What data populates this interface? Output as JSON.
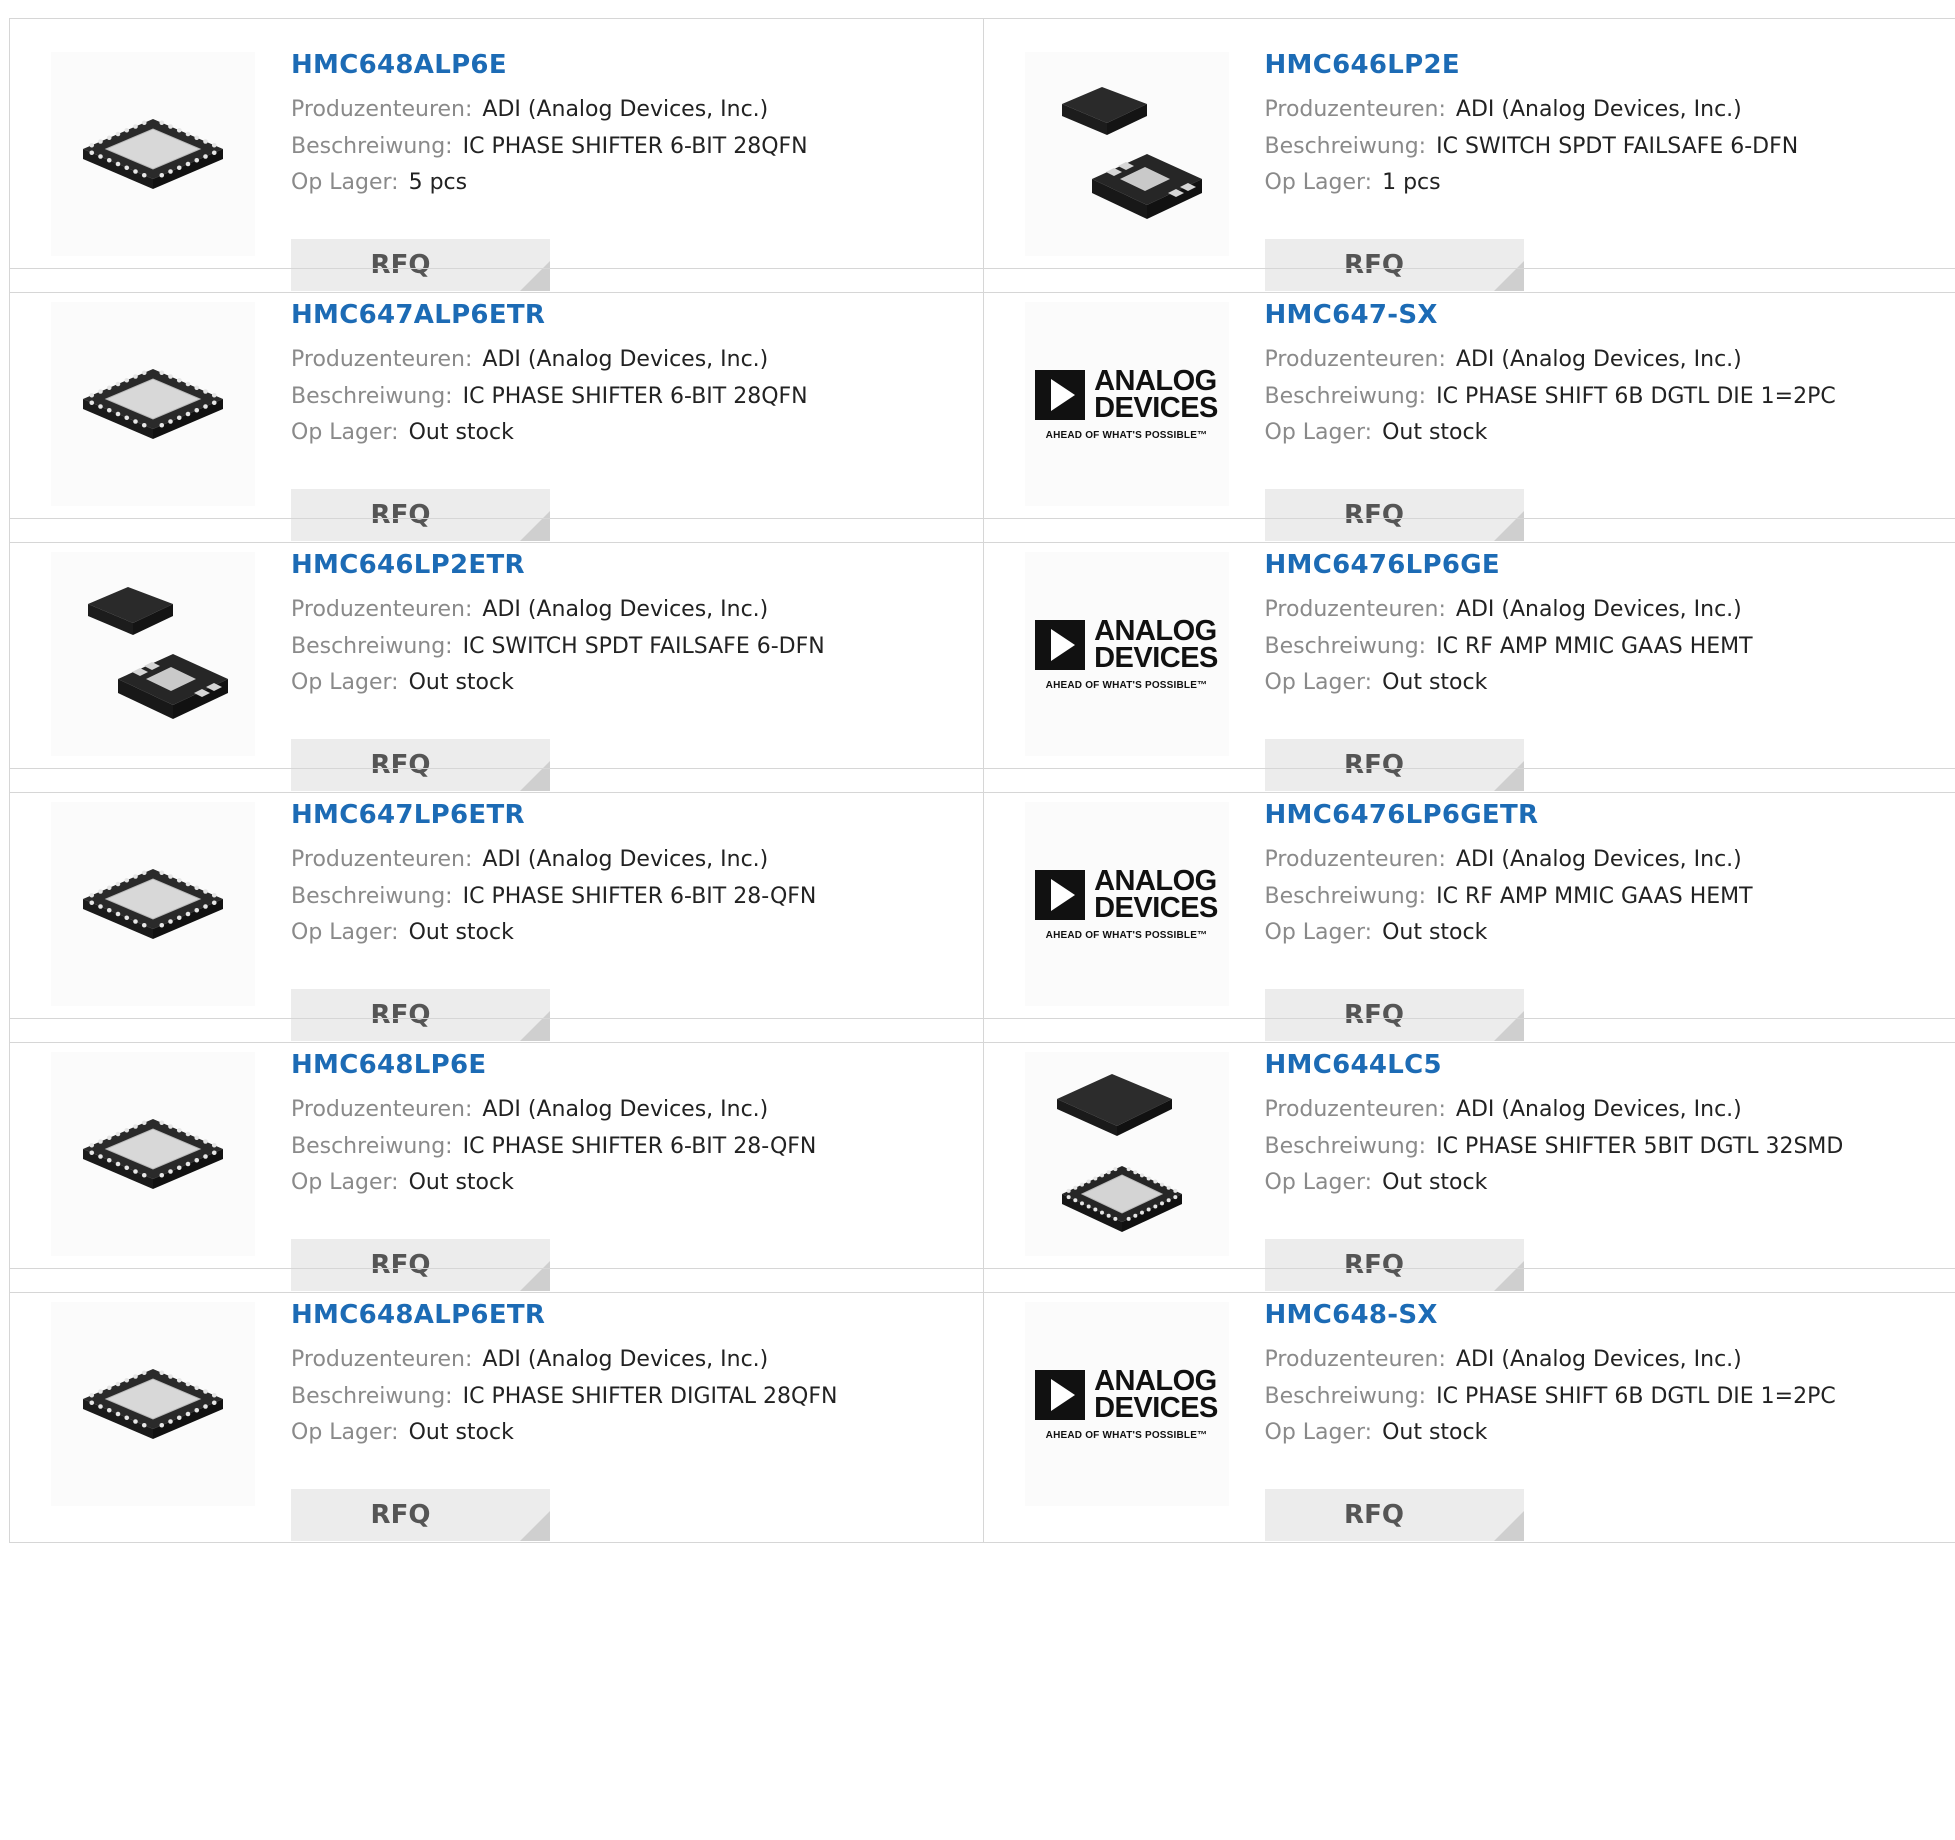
{
  "labels": {
    "manufacturer": "Produzenteuren:",
    "description": "Beschreiwung:",
    "stock": "Op Lager:",
    "rfq": "RFQ"
  },
  "brand_logo": {
    "line1": "ANALOG",
    "line2": "DEVICES",
    "tagline": "AHEAD OF WHAT'S POSSIBLE™"
  },
  "colors": {
    "link": "#1c6bb5",
    "label": "#8a8a8a",
    "value": "#222222",
    "rfq_bg": "#ececec",
    "border": "#d6d6d6"
  },
  "products": [
    {
      "part": "HMC648ALP6E",
      "manufacturer": "ADI (Analog Devices, Inc.)",
      "description": "IC PHASE SHIFTER 6-BIT 28QFN",
      "stock": "5 pcs",
      "image": "qfn-chip-icon"
    },
    {
      "part": "HMC646LP2E",
      "manufacturer": "ADI (Analog Devices, Inc.)",
      "description": "IC SWITCH SPDT FAILSAFE 6-DFN",
      "stock": "1 pcs",
      "image": "dfn-chip-icon"
    },
    {
      "part": "HMC647ALP6ETR",
      "manufacturer": "ADI (Analog Devices, Inc.)",
      "description": "IC PHASE SHIFTER 6-BIT 28QFN",
      "stock": "Out stock",
      "image": "qfn-chip-icon"
    },
    {
      "part": "HMC647-SX",
      "manufacturer": "ADI (Analog Devices, Inc.)",
      "description": "IC PHASE SHIFT 6B DGTL DIE 1=2PC",
      "stock": "Out stock",
      "image": "analog-devices-logo"
    },
    {
      "part": "HMC646LP2ETR",
      "manufacturer": "ADI (Analog Devices, Inc.)",
      "description": "IC SWITCH SPDT FAILSAFE 6-DFN",
      "stock": "Out stock",
      "image": "dfn-chip-icon"
    },
    {
      "part": "HMC6476LP6GE",
      "manufacturer": "ADI (Analog Devices, Inc.)",
      "description": "IC RF AMP MMIC GAAS HEMT",
      "stock": "Out stock",
      "image": "analog-devices-logo"
    },
    {
      "part": "HMC647LP6ETR",
      "manufacturer": "ADI (Analog Devices, Inc.)",
      "description": "IC PHASE SHIFTER 6-BIT 28-QFN",
      "stock": "Out stock",
      "image": "qfn-chip-icon"
    },
    {
      "part": "HMC6476LP6GETR",
      "manufacturer": "ADI (Analog Devices, Inc.)",
      "description": "IC RF AMP MMIC GAAS HEMT",
      "stock": "Out stock",
      "image": "analog-devices-logo"
    },
    {
      "part": "HMC648LP6E",
      "manufacturer": "ADI (Analog Devices, Inc.)",
      "description": "IC PHASE SHIFTER 6-BIT 28-QFN",
      "stock": "Out stock",
      "image": "qfn-chip-icon"
    },
    {
      "part": "HMC644LC5",
      "manufacturer": "ADI (Analog Devices, Inc.)",
      "description": "IC PHASE SHIFTER 5BIT DGTL 32SMD",
      "stock": "Out stock",
      "image": "lc5-chip-icon"
    },
    {
      "part": "HMC648ALP6ETR",
      "manufacturer": "ADI (Analog Devices, Inc.)",
      "description": "IC PHASE SHIFTER DIGITAL 28QFN",
      "stock": "Out stock",
      "image": "qfn-chip-icon"
    },
    {
      "part": "HMC648-SX",
      "manufacturer": "ADI (Analog Devices, Inc.)",
      "description": "IC PHASE SHIFT 6B DGTL DIE 1=2PC",
      "stock": "Out stock",
      "image": "analog-devices-logo"
    }
  ]
}
